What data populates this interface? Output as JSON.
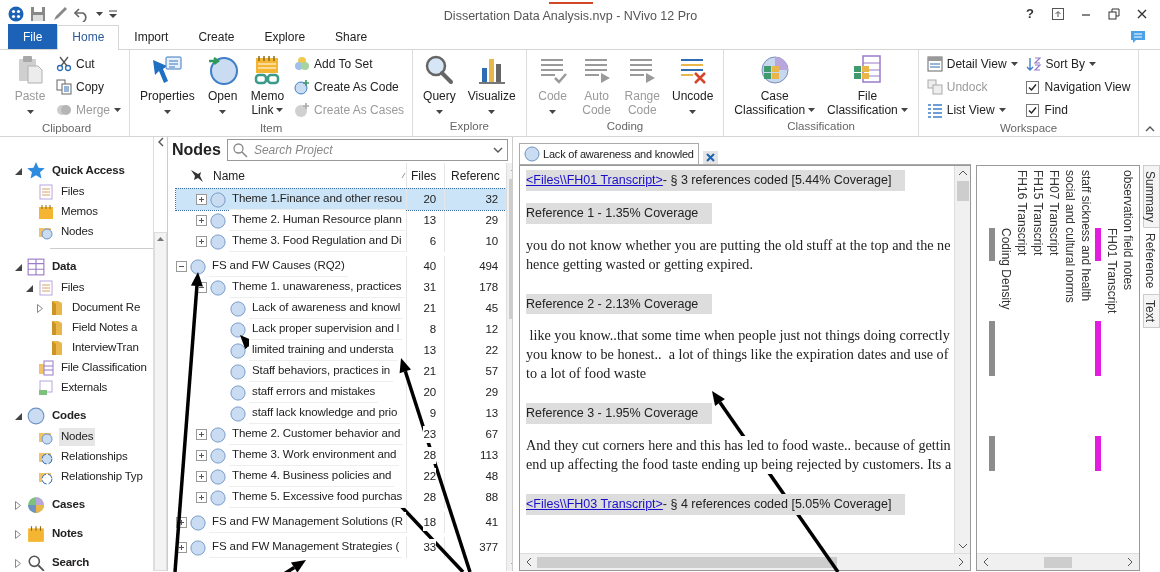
{
  "window": {
    "title": "Dissertation Data Analysis.nvp - NVivo 12 Pro",
    "help": "?"
  },
  "ribbon_tabs": [
    {
      "label": "File",
      "kind": "backstage",
      "selected": false
    },
    {
      "label": "Home",
      "kind": "tab",
      "selected": true
    },
    {
      "label": "Import",
      "kind": "tab",
      "selected": false
    },
    {
      "label": "Create",
      "kind": "tab",
      "selected": false
    },
    {
      "label": "Explore",
      "kind": "tab",
      "selected": false
    },
    {
      "label": "Share",
      "kind": "tab",
      "selected": false
    }
  ],
  "ribbon_groups": [
    {
      "label": "Clipboard",
      "items": [
        {
          "label": "Paste",
          "kind": "large",
          "disabled": true,
          "dropdown": true
        },
        {
          "label": "Cut",
          "kind": "small",
          "disabled": false
        },
        {
          "label": "Copy",
          "kind": "small",
          "disabled": false
        },
        {
          "label": "Merge",
          "kind": "small",
          "disabled": true,
          "dropdown": true
        }
      ]
    },
    {
      "label": "Item",
      "items": [
        {
          "label": "Properties",
          "kind": "large",
          "disabled": false,
          "dropdown": true
        },
        {
          "label": "Open",
          "kind": "large",
          "disabled": false,
          "dropdown": true
        },
        {
          "label": "Memo\nLink",
          "kind": "large",
          "disabled": false,
          "dropdown": true
        },
        {
          "label": "Add To Set",
          "kind": "small",
          "disabled": false
        },
        {
          "label": "Create As Code",
          "kind": "small",
          "disabled": false
        },
        {
          "label": "Create As Cases",
          "kind": "small",
          "disabled": true
        }
      ]
    },
    {
      "label": "Explore",
      "items": [
        {
          "label": "Query",
          "kind": "large",
          "disabled": false,
          "dropdown": true
        },
        {
          "label": "Visualize",
          "kind": "large",
          "disabled": false,
          "dropdown": true
        }
      ]
    },
    {
      "label": "Coding",
      "items": [
        {
          "label": "Code",
          "kind": "large",
          "disabled": true,
          "dropdown": true
        },
        {
          "label": "Auto\nCode",
          "kind": "large",
          "disabled": true
        },
        {
          "label": "Range\nCode",
          "kind": "large",
          "disabled": true
        },
        {
          "label": "Uncode",
          "kind": "large",
          "disabled": false,
          "dropdown": true
        }
      ]
    },
    {
      "label": "Classification",
      "items": [
        {
          "label": "Case\nClassification",
          "kind": "large",
          "disabled": false,
          "dropdown": true
        },
        {
          "label": "File\nClassification",
          "kind": "large",
          "disabled": false,
          "dropdown": true
        }
      ]
    },
    {
      "label": "Workspace",
      "items": [
        {
          "label": "Detail View",
          "kind": "small",
          "disabled": false,
          "dropdown": true
        },
        {
          "label": "Undock",
          "kind": "small",
          "disabled": true
        },
        {
          "label": "List View",
          "kind": "small",
          "disabled": false,
          "dropdown": true
        },
        {
          "label": "Sort By",
          "kind": "small",
          "disabled": false,
          "dropdown": true
        },
        {
          "label": "Navigation View",
          "kind": "check",
          "checked": true
        },
        {
          "label": "Find",
          "kind": "check",
          "checked": true
        }
      ]
    }
  ],
  "navigation": [
    {
      "label": "Quick Access",
      "expanded": true,
      "selected": false,
      "children": [
        {
          "label": "Files",
          "selected": false
        },
        {
          "label": "Memos",
          "selected": false
        },
        {
          "label": "Nodes",
          "selected": false
        }
      ]
    },
    {
      "label": "Data",
      "expanded": true,
      "selected": false,
      "children": [
        {
          "label": "Files",
          "expanded": true,
          "selected": false,
          "children": [
            {
              "label": "Document Re",
              "expanded": false,
              "selected": false
            },
            {
              "label": "Field Notes a",
              "selected": false
            },
            {
              "label": "InterviewTran",
              "selected": false
            }
          ]
        },
        {
          "label": "File Classification",
          "selected": false
        },
        {
          "label": "Externals",
          "selected": false
        }
      ]
    },
    {
      "label": "Codes",
      "expanded": true,
      "selected": false,
      "children": [
        {
          "label": "Nodes",
          "selected": true
        },
        {
          "label": "Relationships",
          "selected": false
        },
        {
          "label": "Relationship Typ",
          "selected": false
        }
      ]
    },
    {
      "label": "Cases",
      "expanded": false,
      "selected": false
    },
    {
      "label": "Notes",
      "expanded": false,
      "selected": false
    },
    {
      "label": "Search",
      "expanded": false,
      "selected": false
    }
  ],
  "nodes_panel": {
    "title": "Nodes",
    "search": {
      "placeholder": "Search Project"
    },
    "columns": [
      "Name",
      "Files",
      "Referenc"
    ],
    "rows": [
      {
        "children": [
          {
            "name": "Theme 1.Finance and other resou",
            "files": "20",
            "references": "32",
            "expanded": false,
            "selected": true
          },
          {
            "name": "Theme 2. Human Resource plann",
            "files": "13",
            "references": "29",
            "expanded": false,
            "selected": false
          },
          {
            "name": "Theme 3. Food Regulation and Di",
            "files": "6",
            "references": "10",
            "expanded": false,
            "selected": false
          }
        ]
      },
      {
        "name": "FS and FW Causes (RQ2)",
        "files": "40",
        "references": "494",
        "expanded": true,
        "selected": false,
        "children": [
          {
            "name": "Theme 1. unawareness, practices",
            "files": "31",
            "references": "178",
            "expanded": true,
            "selected": false,
            "children": [
              {
                "name": "Lack of awareness and knowl",
                "files": "21",
                "references": "45",
                "selected": false
              },
              {
                "name": "Lack proper supervision and l",
                "files": "8",
                "references": "12",
                "selected": false
              },
              {
                "name": "limited training and understa",
                "files": "13",
                "references": "22",
                "selected": false
              },
              {
                "name": "Staff behaviors,  practices in",
                "files": "21",
                "references": "57",
                "selected": false
              },
              {
                "name": "staff errors and mistakes",
                "files": "20",
                "references": "29",
                "selected": false
              },
              {
                "name": "staff lack knowledge and prio",
                "files": "9",
                "references": "13",
                "selected": false
              }
            ]
          },
          {
            "name": "Theme 2. Customer behavior and",
            "files": "23",
            "references": "67",
            "expanded": false,
            "selected": false
          },
          {
            "name": "Theme 3. Work environment and",
            "files": "28",
            "references": "113",
            "expanded": false,
            "selected": false
          },
          {
            "name": "Theme 4. Business policies and",
            "files": "22",
            "references": "48",
            "expanded": false,
            "selected": false
          },
          {
            "name": "Theme 5. Excessive food purchas",
            "files": "28",
            "references": "88",
            "expanded": false,
            "selected": false
          }
        ]
      },
      {
        "name": "FS and FW Management Solutions (R",
        "files": "18",
        "references": "41",
        "expanded": false,
        "selected": false
      },
      {
        "name": "FS and FW Management Strategies (",
        "files": "33",
        "references": "377",
        "expanded": false,
        "selected": false
      }
    ]
  },
  "detail": {
    "tab": {
      "label": "Lack of awareness and knowled",
      "selected": true
    },
    "blocks": [
      {
        "kind": "file",
        "link": "<Files\\\\FH01 Transcript>",
        "text": " - § 3 references coded  [5.44% Coverage]"
      },
      {
        "kind": "reference",
        "text": "Reference 1 - 1.35% Coverage"
      },
      {
        "kind": "passage",
        "text": "you do not know whether you are putting the old stuff at the top and the ne\nhence getting wasted or getting expired."
      },
      {
        "kind": "reference",
        "text": "Reference 2 - 2.13% Coverage"
      },
      {
        "kind": "passage",
        "text": " like you know..that some time when people just not things doing correctly\nyou know to be honest..  a lot of things like the expiration dates and use of\nto a lot of food waste"
      },
      {
        "kind": "reference",
        "text": "Reference 3 - 1.95% Coverage"
      },
      {
        "kind": "passage",
        "text": "And they cut corners here and this has led to food waste.. because of gettin\nend up affecting the food taste ending up being rejected by customers. Its a"
      },
      {
        "kind": "file",
        "link": "<Files\\\\FH03 Transcript>",
        "text": " - § 4 references coded  [5.05% Coverage]"
      }
    ]
  },
  "coding_stripes": [
    {
      "label": "Coding Density",
      "color": "#8c8c8c"
    },
    {
      "label": "FH16 Transcript"
    },
    {
      "label": "FH15 Transcript"
    },
    {
      "label": "FH07 Transcript"
    },
    {
      "label": "social and cultural norms"
    },
    {
      "label": "staff sickness and health"
    },
    {
      "label": "FH01 Transcript",
      "color": "#e21de0"
    },
    {
      "label": "observation field notes"
    }
  ],
  "side_tabs": [
    {
      "label": "Summary",
      "selected": false
    },
    {
      "label": "Reference",
      "selected": true
    },
    {
      "label": "Text",
      "selected": false
    }
  ]
}
